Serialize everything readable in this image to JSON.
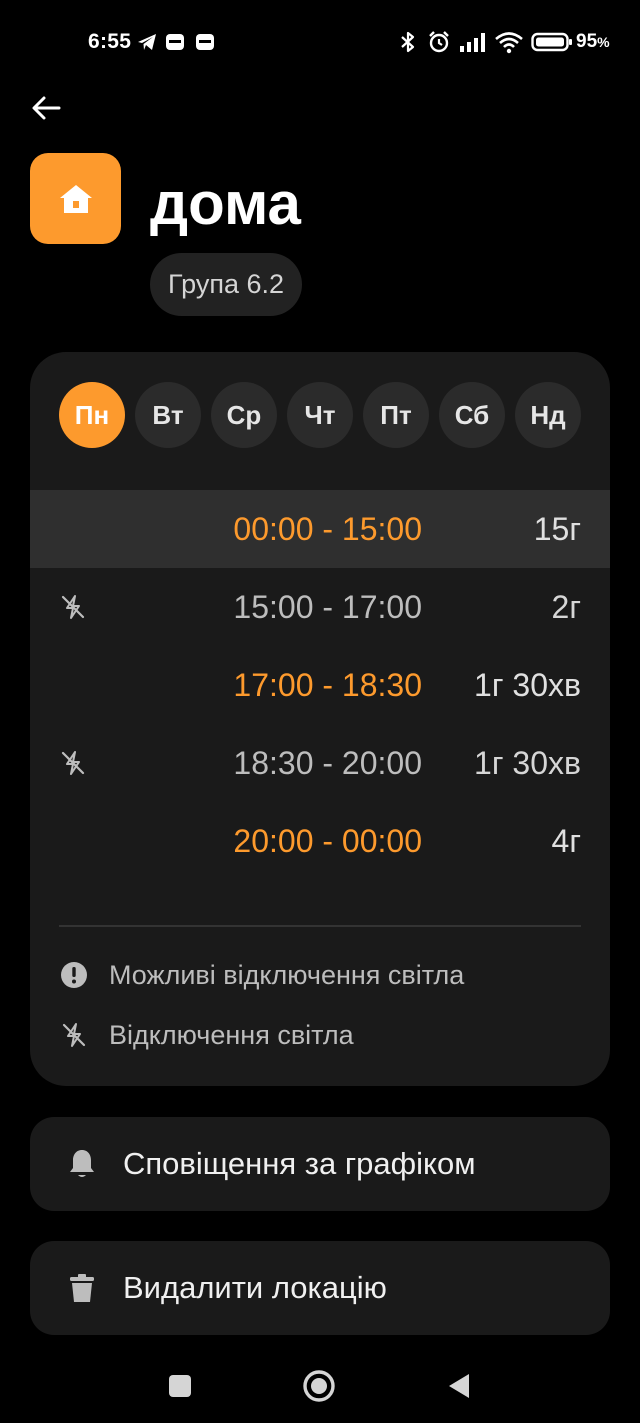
{
  "status_bar": {
    "time": "6:55",
    "battery": "95",
    "battery_unit": "%"
  },
  "header": {
    "title": "дома",
    "group": "Група 6.2",
    "accent": "#fd9a2d"
  },
  "days": [
    {
      "label": "Пн",
      "active": true
    },
    {
      "label": "Вт",
      "active": false
    },
    {
      "label": "Ср",
      "active": false
    },
    {
      "label": "Чт",
      "active": false
    },
    {
      "label": "Пт",
      "active": false
    },
    {
      "label": "Сб",
      "active": false
    },
    {
      "label": "Нд",
      "active": false
    }
  ],
  "slots": [
    {
      "time": "00:00 - 15:00",
      "duration": "15г",
      "state": "on",
      "current": true
    },
    {
      "time": "15:00 - 17:00",
      "duration": "2г",
      "state": "off",
      "current": false
    },
    {
      "time": "17:00 - 18:30",
      "duration": "1г 30хв",
      "state": "on",
      "current": false
    },
    {
      "time": "18:30 - 20:00",
      "duration": "1г 30хв",
      "state": "off",
      "current": false
    },
    {
      "time": "20:00 - 00:00",
      "duration": "4г",
      "state": "on",
      "current": false
    }
  ],
  "legend": {
    "possible": "Можливі відключення світла",
    "outage": "Відключення світла"
  },
  "actions": {
    "notifications": "Сповіщення за графіком",
    "delete": "Видалити локацію"
  }
}
